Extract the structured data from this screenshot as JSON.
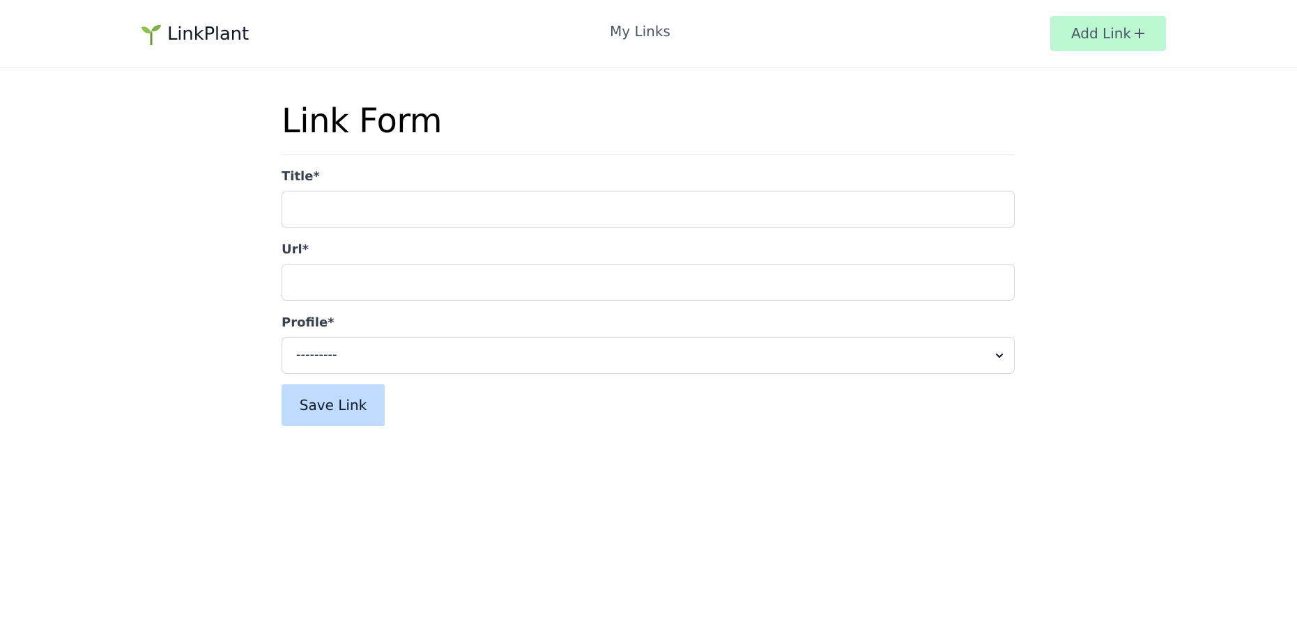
{
  "navbar": {
    "brand_icon": "sprout-icon",
    "brand_name": "LinkPlant",
    "nav_link": "My Links",
    "add_button_label": "Add Link",
    "add_button_icon": "plus-icon"
  },
  "form": {
    "title": "Link Form",
    "fields": {
      "title": {
        "label": "Title*",
        "value": ""
      },
      "url": {
        "label": "Url*",
        "value": ""
      },
      "profile": {
        "label": "Profile*",
        "selected": "---------"
      }
    },
    "submit_label": "Save Link"
  },
  "colors": {
    "add_button_bg": "#bbf7d0",
    "save_button_bg": "#bfdbfe",
    "sprout_green": "#7cb342"
  }
}
